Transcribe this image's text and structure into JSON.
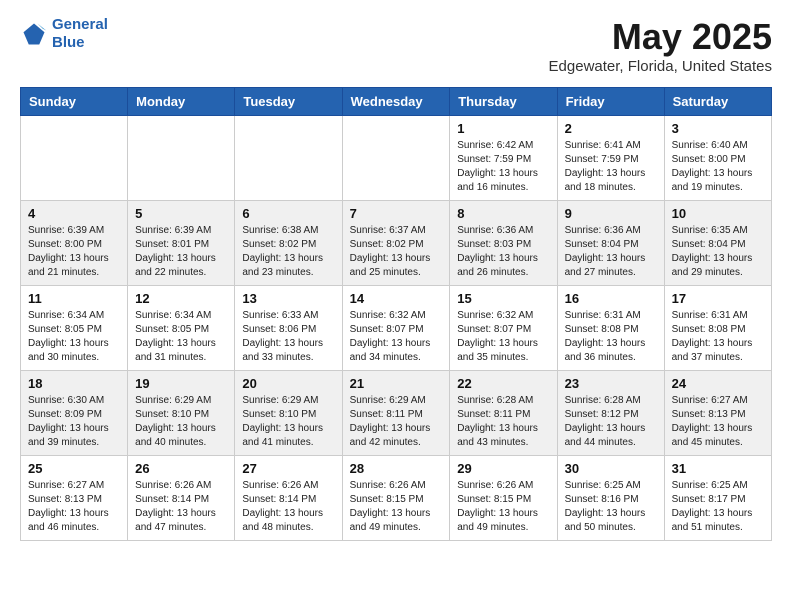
{
  "logo": {
    "line1": "General",
    "line2": "Blue"
  },
  "header": {
    "month": "May 2025",
    "location": "Edgewater, Florida, United States"
  },
  "days_of_week": [
    "Sunday",
    "Monday",
    "Tuesday",
    "Wednesday",
    "Thursday",
    "Friday",
    "Saturday"
  ],
  "weeks": [
    [
      {
        "day": "",
        "info": ""
      },
      {
        "day": "",
        "info": ""
      },
      {
        "day": "",
        "info": ""
      },
      {
        "day": "",
        "info": ""
      },
      {
        "day": "1",
        "info": "Sunrise: 6:42 AM\nSunset: 7:59 PM\nDaylight: 13 hours\nand 16 minutes."
      },
      {
        "day": "2",
        "info": "Sunrise: 6:41 AM\nSunset: 7:59 PM\nDaylight: 13 hours\nand 18 minutes."
      },
      {
        "day": "3",
        "info": "Sunrise: 6:40 AM\nSunset: 8:00 PM\nDaylight: 13 hours\nand 19 minutes."
      }
    ],
    [
      {
        "day": "4",
        "info": "Sunrise: 6:39 AM\nSunset: 8:00 PM\nDaylight: 13 hours\nand 21 minutes."
      },
      {
        "day": "5",
        "info": "Sunrise: 6:39 AM\nSunset: 8:01 PM\nDaylight: 13 hours\nand 22 minutes."
      },
      {
        "day": "6",
        "info": "Sunrise: 6:38 AM\nSunset: 8:02 PM\nDaylight: 13 hours\nand 23 minutes."
      },
      {
        "day": "7",
        "info": "Sunrise: 6:37 AM\nSunset: 8:02 PM\nDaylight: 13 hours\nand 25 minutes."
      },
      {
        "day": "8",
        "info": "Sunrise: 6:36 AM\nSunset: 8:03 PM\nDaylight: 13 hours\nand 26 minutes."
      },
      {
        "day": "9",
        "info": "Sunrise: 6:36 AM\nSunset: 8:04 PM\nDaylight: 13 hours\nand 27 minutes."
      },
      {
        "day": "10",
        "info": "Sunrise: 6:35 AM\nSunset: 8:04 PM\nDaylight: 13 hours\nand 29 minutes."
      }
    ],
    [
      {
        "day": "11",
        "info": "Sunrise: 6:34 AM\nSunset: 8:05 PM\nDaylight: 13 hours\nand 30 minutes."
      },
      {
        "day": "12",
        "info": "Sunrise: 6:34 AM\nSunset: 8:05 PM\nDaylight: 13 hours\nand 31 minutes."
      },
      {
        "day": "13",
        "info": "Sunrise: 6:33 AM\nSunset: 8:06 PM\nDaylight: 13 hours\nand 33 minutes."
      },
      {
        "day": "14",
        "info": "Sunrise: 6:32 AM\nSunset: 8:07 PM\nDaylight: 13 hours\nand 34 minutes."
      },
      {
        "day": "15",
        "info": "Sunrise: 6:32 AM\nSunset: 8:07 PM\nDaylight: 13 hours\nand 35 minutes."
      },
      {
        "day": "16",
        "info": "Sunrise: 6:31 AM\nSunset: 8:08 PM\nDaylight: 13 hours\nand 36 minutes."
      },
      {
        "day": "17",
        "info": "Sunrise: 6:31 AM\nSunset: 8:08 PM\nDaylight: 13 hours\nand 37 minutes."
      }
    ],
    [
      {
        "day": "18",
        "info": "Sunrise: 6:30 AM\nSunset: 8:09 PM\nDaylight: 13 hours\nand 39 minutes."
      },
      {
        "day": "19",
        "info": "Sunrise: 6:29 AM\nSunset: 8:10 PM\nDaylight: 13 hours\nand 40 minutes."
      },
      {
        "day": "20",
        "info": "Sunrise: 6:29 AM\nSunset: 8:10 PM\nDaylight: 13 hours\nand 41 minutes."
      },
      {
        "day": "21",
        "info": "Sunrise: 6:29 AM\nSunset: 8:11 PM\nDaylight: 13 hours\nand 42 minutes."
      },
      {
        "day": "22",
        "info": "Sunrise: 6:28 AM\nSunset: 8:11 PM\nDaylight: 13 hours\nand 43 minutes."
      },
      {
        "day": "23",
        "info": "Sunrise: 6:28 AM\nSunset: 8:12 PM\nDaylight: 13 hours\nand 44 minutes."
      },
      {
        "day": "24",
        "info": "Sunrise: 6:27 AM\nSunset: 8:13 PM\nDaylight: 13 hours\nand 45 minutes."
      }
    ],
    [
      {
        "day": "25",
        "info": "Sunrise: 6:27 AM\nSunset: 8:13 PM\nDaylight: 13 hours\nand 46 minutes."
      },
      {
        "day": "26",
        "info": "Sunrise: 6:26 AM\nSunset: 8:14 PM\nDaylight: 13 hours\nand 47 minutes."
      },
      {
        "day": "27",
        "info": "Sunrise: 6:26 AM\nSunset: 8:14 PM\nDaylight: 13 hours\nand 48 minutes."
      },
      {
        "day": "28",
        "info": "Sunrise: 6:26 AM\nSunset: 8:15 PM\nDaylight: 13 hours\nand 49 minutes."
      },
      {
        "day": "29",
        "info": "Sunrise: 6:26 AM\nSunset: 8:15 PM\nDaylight: 13 hours\nand 49 minutes."
      },
      {
        "day": "30",
        "info": "Sunrise: 6:25 AM\nSunset: 8:16 PM\nDaylight: 13 hours\nand 50 minutes."
      },
      {
        "day": "31",
        "info": "Sunrise: 6:25 AM\nSunset: 8:17 PM\nDaylight: 13 hours\nand 51 minutes."
      }
    ]
  ]
}
